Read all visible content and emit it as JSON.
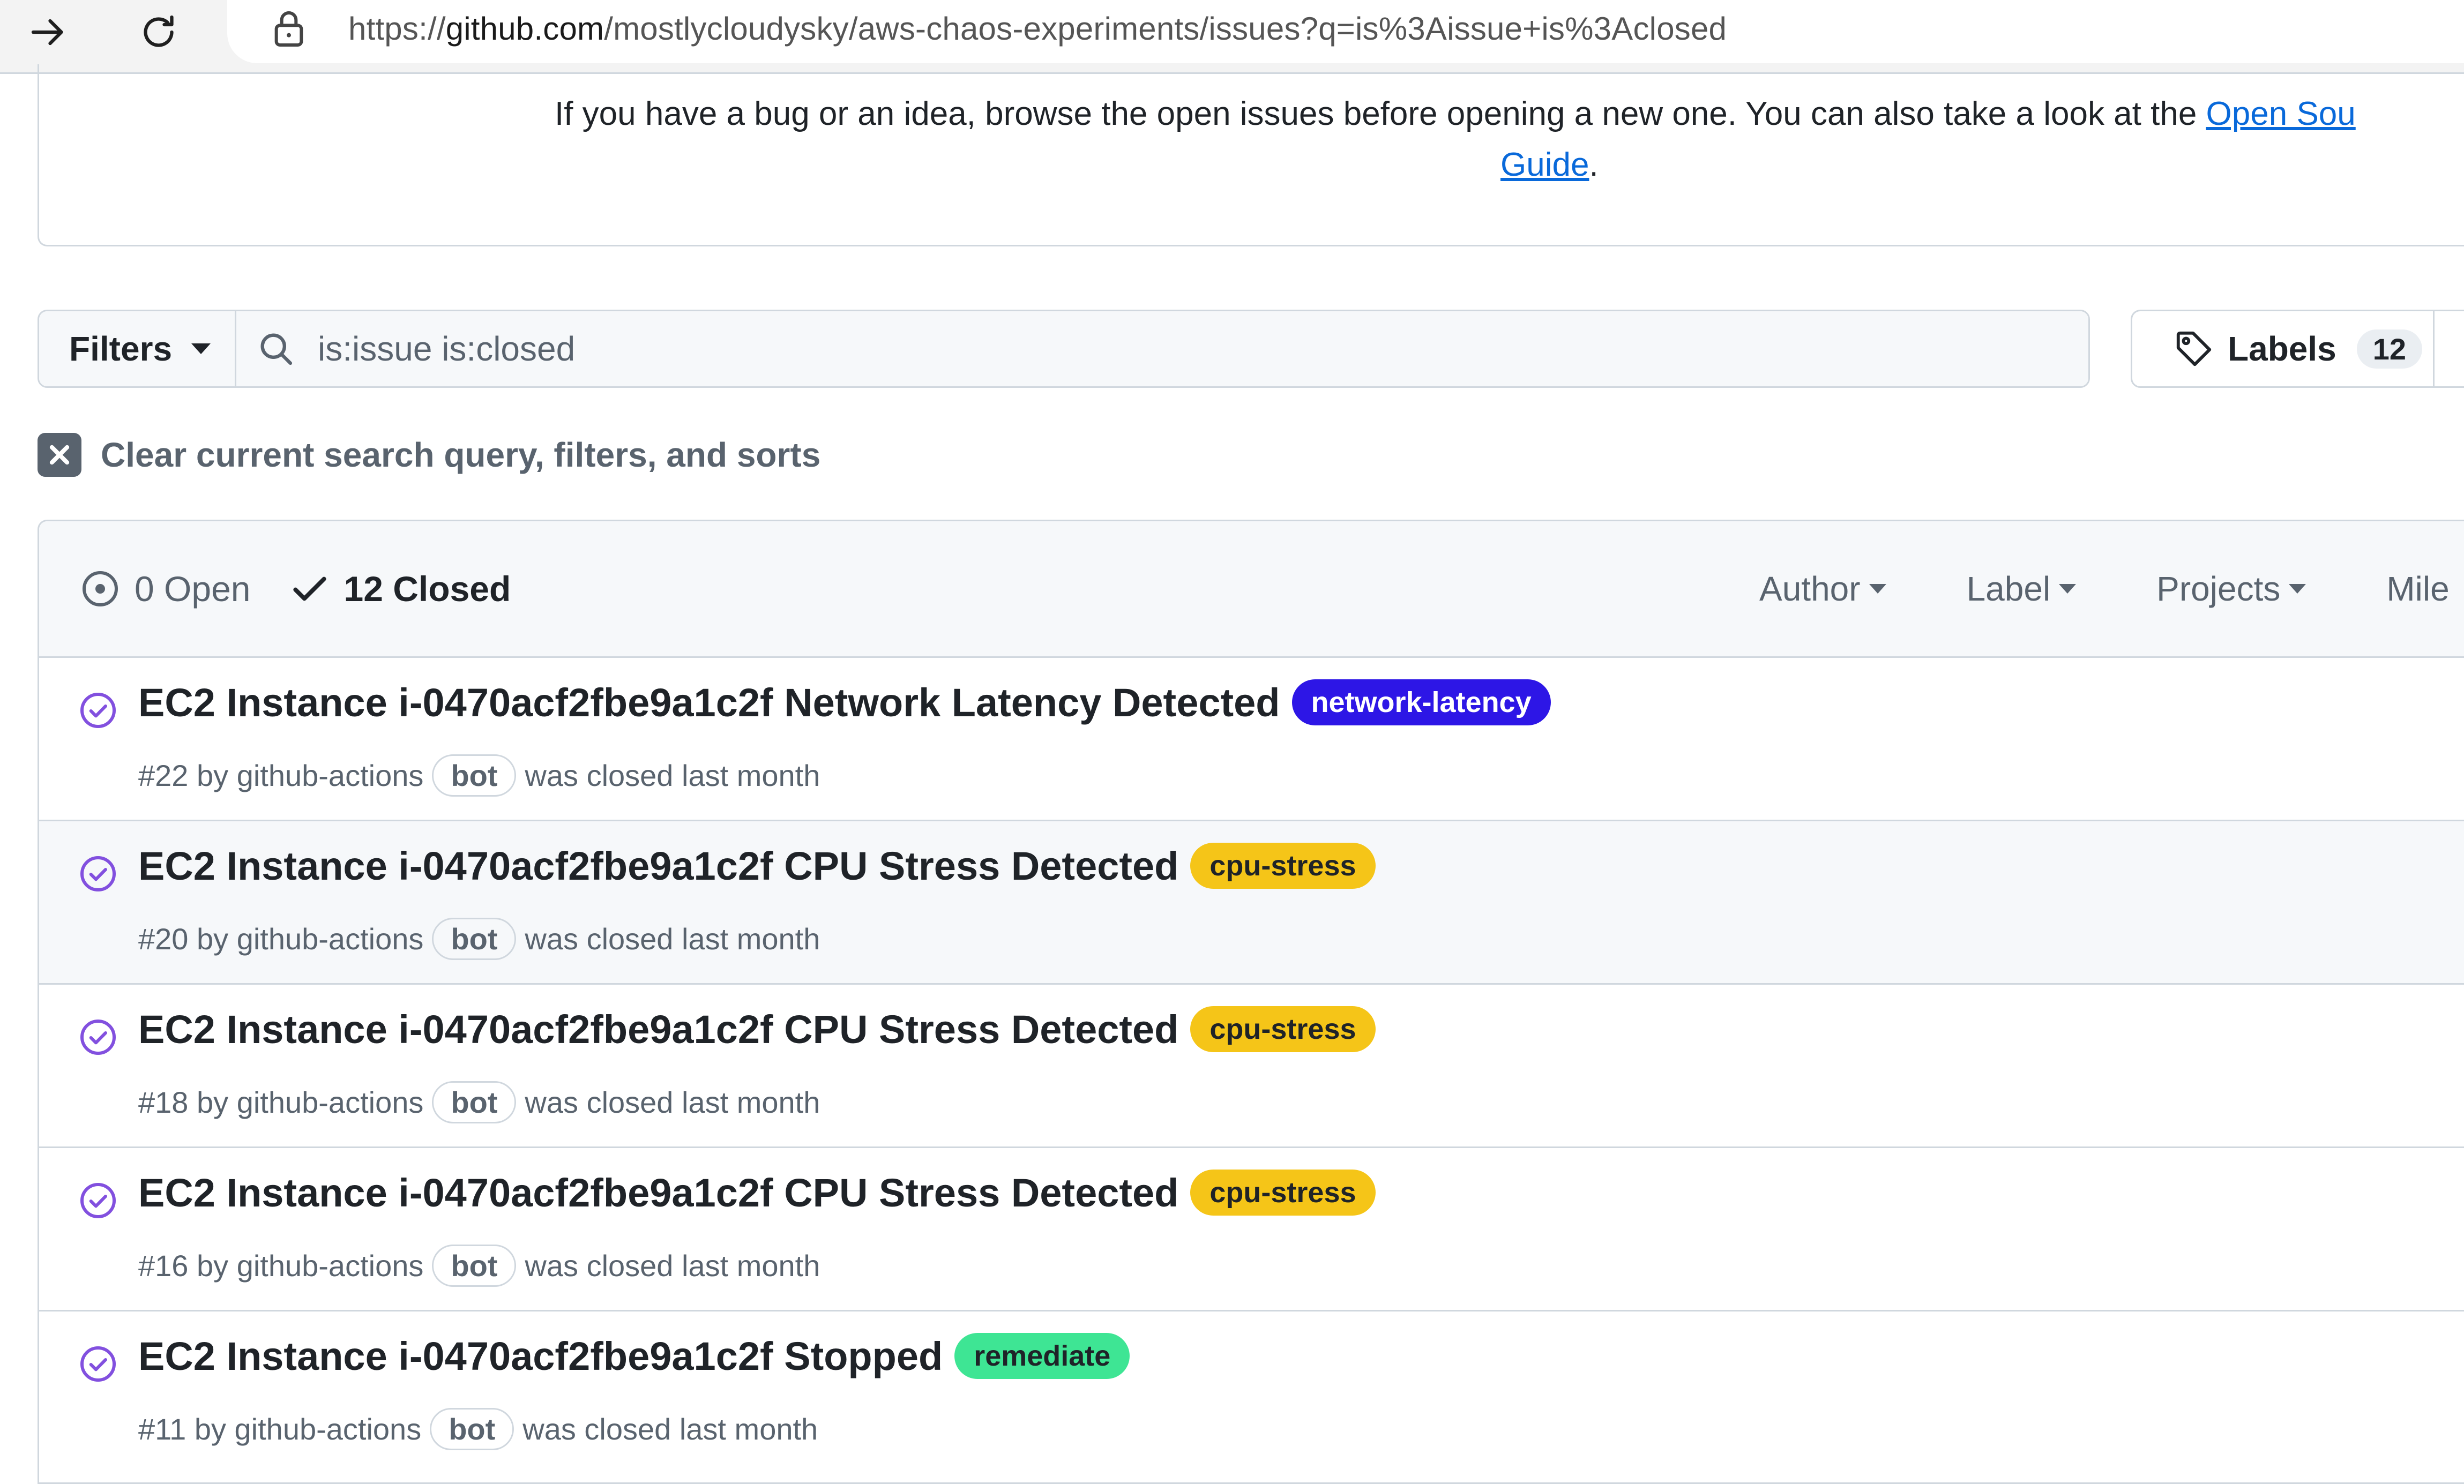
{
  "browser": {
    "url_prefix": "https://",
    "url_host": "github.com",
    "url_path": "/mostlycloudysky/aws-chaos-experiments/issues?q=is%3Aissue+is%3Aclosed"
  },
  "notice": {
    "text": "If you have a bug or an idea, browse the open issues before opening a new one. You can also take a look at the",
    "link": "Open Sou",
    "link2": "Guide",
    "period": "."
  },
  "filters": {
    "button_label": "Filters",
    "search_value": "is:issue is:closed"
  },
  "labels_button": {
    "label": "Labels",
    "count": "12"
  },
  "clear": {
    "text": "Clear current search query, filters, and sorts"
  },
  "issues_header": {
    "open_label": "0 Open",
    "closed_label": "12 Closed",
    "filters": [
      "Author",
      "Label",
      "Projects",
      "Mile"
    ]
  },
  "issues": [
    {
      "title": "EC2 Instance i-0470acf2fbe9a1c2f Network Latency Detected",
      "label": "network-latency",
      "label_bg": "#2d16e6",
      "label_fg": "#ffffff",
      "meta_prefix": "#22 by github-actions",
      "bot": "bot",
      "meta_suffix": "was closed last month"
    },
    {
      "title": "EC2 Instance i-0470acf2fbe9a1c2f CPU Stress Detected",
      "label": "cpu-stress",
      "label_bg": "#f5c518",
      "label_fg": "#1f2328",
      "meta_prefix": "#20 by github-actions",
      "bot": "bot",
      "meta_suffix": "was closed last month"
    },
    {
      "title": "EC2 Instance i-0470acf2fbe9a1c2f CPU Stress Detected",
      "label": "cpu-stress",
      "label_bg": "#f5c518",
      "label_fg": "#1f2328",
      "meta_prefix": "#18 by github-actions",
      "bot": "bot",
      "meta_suffix": "was closed last month"
    },
    {
      "title": "EC2 Instance i-0470acf2fbe9a1c2f CPU Stress Detected",
      "label": "cpu-stress",
      "label_bg": "#f5c518",
      "label_fg": "#1f2328",
      "meta_prefix": "#16 by github-actions",
      "bot": "bot",
      "meta_suffix": "was closed last month"
    },
    {
      "title": "EC2 Instance i-0470acf2fbe9a1c2f Stopped",
      "label": "remediate",
      "label_bg": "#3ee594",
      "label_fg": "#1f2328",
      "meta_prefix": "#11 by github-actions",
      "bot": "bot",
      "meta_suffix": "was closed last month"
    }
  ],
  "colors": {
    "link": "#0969da",
    "closed_issue_icon": "#8250df",
    "border": "#d0d7de"
  },
  "icons": [
    "forward-arrow-icon",
    "reload-icon",
    "lock-icon",
    "search-icon",
    "tag-icon",
    "clear-x-icon",
    "issue-opened-icon",
    "check-icon",
    "issue-closed-icon",
    "caret-down-icon"
  ]
}
